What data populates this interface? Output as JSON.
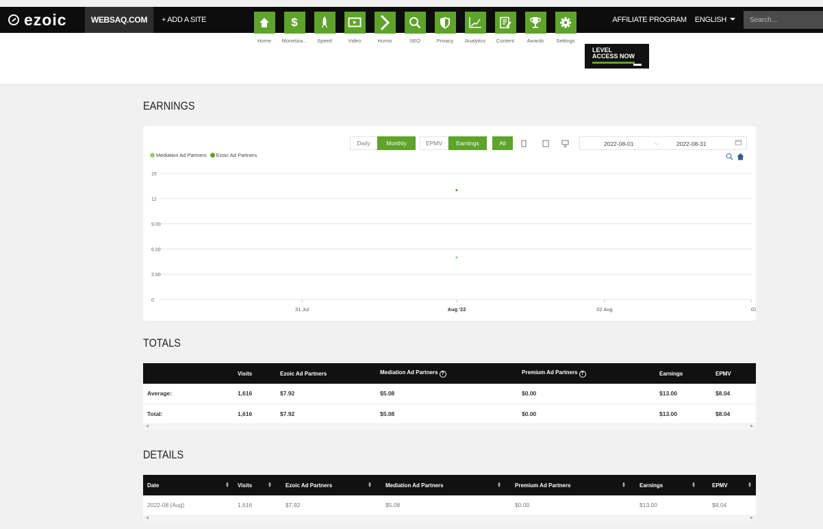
{
  "topbar": {
    "logo": "ezoic",
    "site": "WEBSAQ.COM",
    "add_site": "+ ADD A SITE",
    "affiliate": "AFFILIATE PROGRAM",
    "language": "ENGLISH",
    "search_placeholder": "Search..."
  },
  "nav": {
    "items": [
      {
        "label": "Home",
        "icon": "home-icon"
      },
      {
        "label": "Monetiza...",
        "icon": "dollar-icon"
      },
      {
        "label": "Speed",
        "icon": "rocket-icon"
      },
      {
        "label": "Video",
        "icon": "video-icon"
      },
      {
        "label": "Humix",
        "icon": "chevron-right-icon"
      },
      {
        "label": "SEO",
        "icon": "magnifier-icon"
      },
      {
        "label": "Privacy",
        "icon": "shield-icon"
      },
      {
        "label": "Analytics",
        "icon": "chart-line-icon"
      },
      {
        "label": "Content",
        "icon": "document-edit-icon"
      },
      {
        "label": "Awards",
        "icon": "trophy-icon"
      },
      {
        "label": "Settings",
        "icon": "gear-icon"
      }
    ],
    "level_line1": "LEVEL",
    "level_line2": "ACCESS NOW"
  },
  "earnings": {
    "title": "EARNINGS",
    "controls": {
      "daily": "Daily",
      "monthly": "Monthly",
      "epmv": "EPMV",
      "earnings": "Earnings",
      "all": "All",
      "start_date": "2022-08-01",
      "separator": "~",
      "end_date": "2022-08-31"
    }
  },
  "chart_data": {
    "type": "scatter",
    "legend": [
      "Mediation Ad Partners",
      "Ezoic Ad Partners"
    ],
    "legend_position": "top-left",
    "colors": {
      "Mediation Ad Partners": "#9ccb72",
      "Ezoic Ad Partners": "#5fa32b"
    },
    "y_ticks": [
      "15",
      "12",
      "9.00",
      "6.00",
      "3.00",
      "0"
    ],
    "ylim": [
      0,
      15
    ],
    "x_ticks": [
      "31 Jul",
      "Aug '22",
      "02 Aug",
      "03 Au"
    ],
    "series": [
      {
        "name": "Ezoic Ad Partners",
        "x": [
          "Aug '22"
        ],
        "values": [
          13
        ]
      },
      {
        "name": "Mediation Ad Partners",
        "x": [
          "Aug '22"
        ],
        "values": [
          5
        ]
      }
    ],
    "grid": true
  },
  "totals": {
    "title": "TOTALS",
    "columns": [
      "",
      "Visits",
      "Ezoic Ad Partners",
      "Mediation Ad Partners",
      "Premium Ad Partners",
      "Earnings",
      "EPMV"
    ],
    "rows": [
      [
        "Average:",
        "1,616",
        "$7.92",
        "$5.08",
        "$0.00",
        "$13.00",
        "$8.04"
      ],
      [
        "Total:",
        "1,616",
        "$7.92",
        "$5.08",
        "$0.00",
        "$13.00",
        "$8.04"
      ]
    ]
  },
  "details": {
    "title": "DETAILS",
    "columns": [
      "Date",
      "Visits",
      "Ezoic Ad Partners",
      "Mediation Ad Partners",
      "Premium Ad Partners",
      "Earnings",
      "EPMV"
    ],
    "rows": [
      [
        "2022-08 (Aug)",
        "1,616",
        "$7.92",
        "$5.08",
        "$0.00",
        "$13.00",
        "$8.04"
      ]
    ]
  }
}
